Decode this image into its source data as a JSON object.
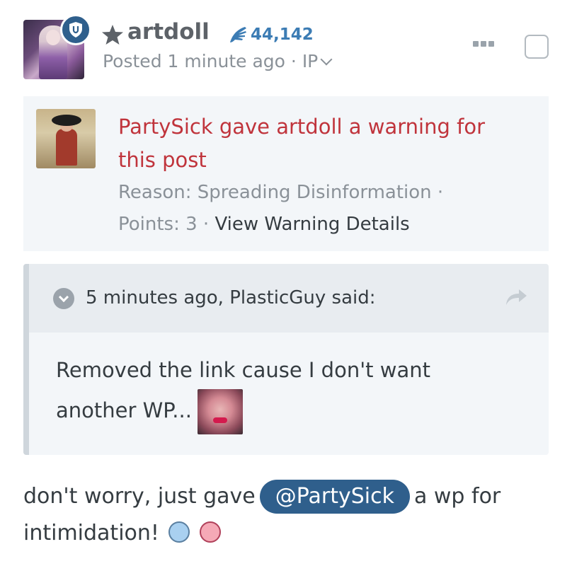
{
  "post": {
    "username": "artdoll",
    "reputation": "44,142",
    "posted": "Posted 1 minute ago",
    "ip": "IP",
    "separator": " · "
  },
  "warning": {
    "title": "PartySick gave artdoll a warning for this post",
    "reason": "Reason: Spreading Disinformation ·",
    "points": "Points: 3",
    "separator": " · ",
    "view_link": "View Warning Details"
  },
  "quote": {
    "citation": "5 minutes ago, PlasticGuy said:",
    "text": "Removed the link cause I don't want another WP..."
  },
  "reply": {
    "before": "don't worry, just gave",
    "mention": "@PartySick",
    "after": "a wp for intimidation!"
  },
  "colors": {
    "accent": "#2f5f8c",
    "warning_text": "#c0343c",
    "reputation": "#3c7cb4"
  },
  "icons": [
    "shield-icon",
    "star-icon",
    "reputation-hand-icon",
    "more-options-icon",
    "share-arrow-icon",
    "quote-toggle-icon",
    "smile-icon",
    "kiss-icon"
  ]
}
